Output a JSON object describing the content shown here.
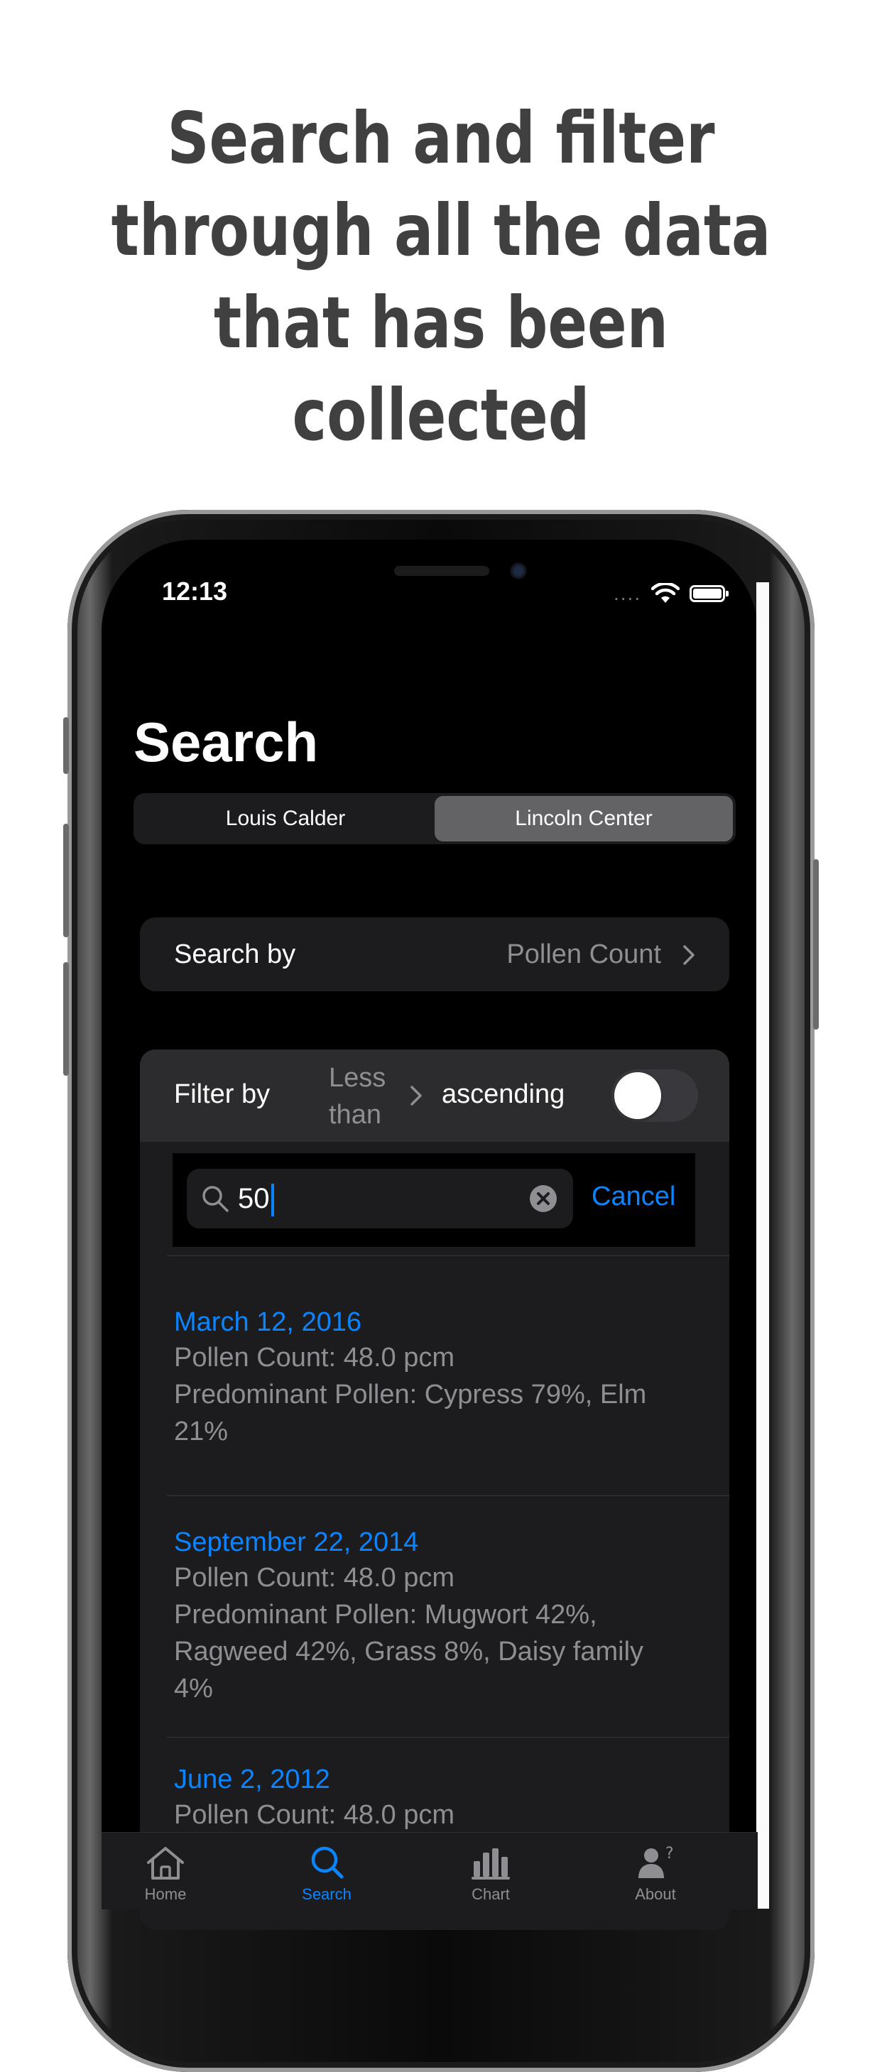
{
  "headline": [
    "Search and filter",
    "through all the data",
    "that has been",
    "collected"
  ],
  "status": {
    "time": "12:13",
    "signal_dots": "...."
  },
  "screen": {
    "title": "Search",
    "segments": [
      "Louis Calder",
      "Lincoln Center"
    ],
    "selected_segment": "Lincoln Center"
  },
  "search_by": {
    "label": "Search by",
    "value": "Pollen Count"
  },
  "filter": {
    "label": "Filter by",
    "operator_line1": "Less",
    "operator_line2": "than",
    "order": "ascending",
    "toggle_on": false
  },
  "search": {
    "value": "50",
    "cancel_label": "Cancel"
  },
  "results": [
    {
      "date": "March 12, 2016",
      "count": "Pollen Count: 48.0 pcm",
      "pollen_lines": [
        "Predominant Pollen: Cypress 79%, Elm",
        "21%"
      ]
    },
    {
      "date": "September 22, 2014",
      "count": "Pollen Count: 48.0 pcm",
      "pollen_lines": [
        "Predominant Pollen: Mugwort 42%,",
        "Ragweed 42%, Grass 8%, Daisy family",
        "4%"
      ]
    },
    {
      "date": "June 2, 2012",
      "count": "Pollen Count: 48.0 pcm",
      "pollen_lines": []
    }
  ],
  "tabs": [
    {
      "label": "Home",
      "icon": "home-icon",
      "active": false
    },
    {
      "label": "Search",
      "icon": "search-icon",
      "active": true
    },
    {
      "label": "Chart",
      "icon": "chart-icon",
      "active": false
    },
    {
      "label": "About",
      "icon": "about-icon",
      "active": false
    }
  ],
  "colors": {
    "accent": "#0a84ff",
    "background": "#000000",
    "card": "#1c1c1e",
    "headline": "#404040"
  }
}
